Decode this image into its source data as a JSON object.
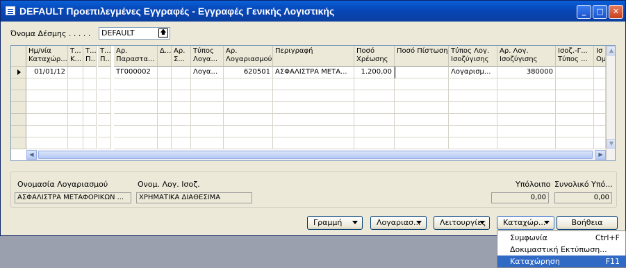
{
  "window": {
    "title": "DEFAULT Προεπιλεγμένες Εγγραφές - Εγγραφές Γενικής Λογιστικής"
  },
  "batch": {
    "label": "Όνομα Δέσμης  . . . . .",
    "value": "DEFAULT"
  },
  "grid": {
    "headers": [
      [
        "Ημ/νία",
        "Καταχώρ..."
      ],
      [
        "Τ...",
        "Κ..."
      ],
      [
        "Τ...",
        "Π..."
      ],
      [
        "Τ...",
        "Π..."
      ],
      [
        "Αρ.",
        "Παραστα..."
      ],
      [
        "",
        "Δ..."
      ],
      [
        "Αρ.",
        "Σ..."
      ],
      [
        "Τύπος",
        "Λογα..."
      ],
      [
        "Αρ.",
        "Λογαριασμού"
      ],
      [
        "",
        "Περιγραφή"
      ],
      [
        "Ποσό",
        "Χρέωσης"
      ],
      [
        "",
        "Ποσό Πίστωσης"
      ],
      [
        "Τύπος Λογ.",
        "Ισοζύγισης"
      ],
      [
        "Αρ. Λογ.",
        "Ισοζύγισης"
      ],
      [
        "Ισοζ.-Γ...",
        "Τύπος ..."
      ],
      [
        "Ισ",
        "Ομ"
      ]
    ],
    "rows": [
      [
        "01/01/12",
        "",
        "",
        "",
        "ΤΓ000002",
        "",
        "",
        "Λογα...",
        "620501",
        "ΑΣΦΑΛΙΣΤΡΑ ΜΕΤΑ...",
        "1.200,00",
        "",
        "Λογαρισμ...",
        "380000",
        "",
        ""
      ]
    ]
  },
  "footer": {
    "account_name_label": "Ονομασία Λογαριασμού",
    "account_name_value": "ΑΣΦΑΛΙΣΤΡΑ ΜΕΤΑΦΟΡΙΚΩΝ ...",
    "bal_account_label": "Ονομ. Λογ. Ισοζ.",
    "bal_account_value": "ΧΡΗΜΑΤΙΚΑ ΔΙΑΘΕΣΙΜΑ",
    "balance_label": "Υπόλοιπο",
    "balance_value": "0,00",
    "total_balance_label": "Συνολικό Υπό...",
    "total_balance_value": "0,00"
  },
  "buttons": {
    "line": "Γραμμή",
    "account": "Λογαριασ...",
    "functions": "Λειτουργίες",
    "posting": "Καταχώρ...",
    "help": "Βοήθεια"
  },
  "menu": {
    "items": [
      {
        "label": "Συμφωνία",
        "shortcut": "Ctrl+F"
      },
      {
        "label": "Δοκιμαστική Εκτύπωση...",
        "shortcut": ""
      },
      {
        "label": "Καταχώρηση",
        "shortcut": "F11"
      }
    ]
  }
}
